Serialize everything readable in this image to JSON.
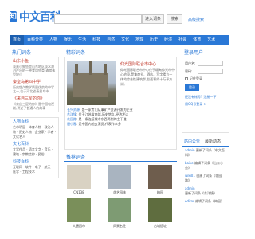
{
  "header": {
    "logo_badge": "知",
    "logo_text": "中文百科",
    "search_placeholder": "",
    "entry_button": "进入词条",
    "search_button": "搜索",
    "advanced_link": "高级搜索"
  },
  "nav": [
    "首页",
    "百科分类",
    "人物",
    "娱乐",
    "生活",
    "科技",
    "自然",
    "文化",
    "地理",
    "历史",
    "经济",
    "社会",
    "体育",
    "艺术"
  ],
  "hot": {
    "title": "热门词条",
    "items": [
      {
        "title": "山东小鱼",
        "desc": "淡黄小鲜鱼是山东地区淡水湖泊产出的一种食用鱼类,通常体型较小"
      },
      {
        "title": "秦皇岛第四中学",
        "desc": "历史悠久教学质量优良的中学之一,位于河北省秦皇岛市"
      },
      {
        "title": "《来自三星的你》",
        "desc": "《来自三星的你》是中国电视剧,讲述了普通人的故事"
      }
    ]
  },
  "categories": [
    {
      "title": "人物百科",
      "links": "艺术明星 · 体育人物 · 政治人物 · 历史人物 · 企业家 · 学者 · 文化名人"
    },
    {
      "title": "文化百科",
      "links": "文学作品 · 语言文字 · 音乐 · 建筑 · 宗教信仰 · 民俗"
    },
    {
      "title": "科技百科",
      "links": "互联网 · 软件 · 电子 · 航天 · 医学 · 工程技术"
    }
  ],
  "featured": {
    "section_title": "精彩词条",
    "entry_title": "仰光国际联合市中心",
    "entry_desc": "仰光国际联合市中心位于缅甸仰光市中心地段,是集商业、酒店、写字楼为一体的综合性建筑群,总面积约十万平方米。",
    "list": [
      {
        "name": "长兴资源",
        "text": "是一家专门从事矿产资源开发的企业"
      },
      {
        "name": "东洋镇",
        "text": "位于江苏省南部,历史悠久,经济发达"
      },
      {
        "name": "花园路",
        "text": "是一条连接城市东西两侧的主干道"
      },
      {
        "name": "唐小雅",
        "text": "是中国内地女演员,代表作众多"
      }
    ]
  },
  "recommended": {
    "section_title": "推荐词条",
    "items": [
      {
        "caption": "CN138",
        "color": "#d9d2c3"
      },
      {
        "caption": "花艺园林",
        "color": "#a9b4c0"
      },
      {
        "caption": "梅园",
        "color": "#6e5d4d"
      },
      {
        "caption": "大唐西市",
        "color": "#7a8f5a"
      },
      {
        "caption": "风景名胜",
        "color": "#7e9b73"
      },
      {
        "caption": "古城遗址",
        "color": "#5f6d3f"
      }
    ]
  },
  "login": {
    "title": "登录用户",
    "username_label": "用户名:",
    "password_label": "密码:",
    "remember": "记住登录",
    "login_button": "登录",
    "register": "还没有帐号? 注册一下",
    "qq": "用QQ号登录 >"
  },
  "dynamics": {
    "tab_notice": "站内公告",
    "tab_news": "最新动态",
    "items": [
      {
        "user": "admin",
        "text": "更新了词条《中文百科》"
      },
      {
        "user": "baike",
        "text": "编辑了词条《山东小鱼》"
      },
      {
        "user": "wiki01",
        "text": "创建了词条《花园路》"
      },
      {
        "user": "admin",
        "text": "更新了词条《东洋镇》"
      },
      {
        "user": "editor",
        "text": "编辑了词条《梅园》"
      }
    ]
  }
}
